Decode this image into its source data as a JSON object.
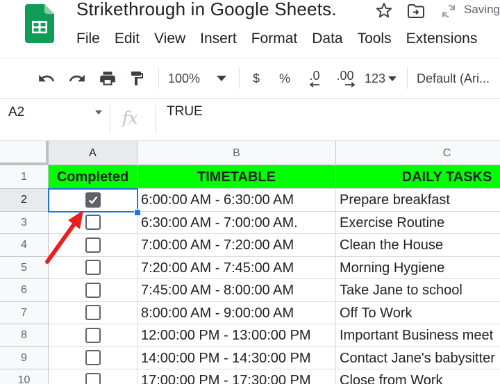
{
  "header": {
    "doc_title": "Strikethrough in Google Sheets.",
    "status": "Saving",
    "menu": [
      "File",
      "Edit",
      "View",
      "Insert",
      "Format",
      "Data",
      "Tools",
      "Extensions"
    ]
  },
  "toolbar": {
    "zoom": "100%",
    "currency": "$",
    "percent": "%",
    "decrease_decimal": ".0",
    "increase_decimal": ".00",
    "more_formats": "123",
    "font": "Default (Ari..."
  },
  "formula_bar": {
    "name_box": "A2",
    "fx": "fx",
    "value": "TRUE"
  },
  "sheet": {
    "columns": [
      "A",
      "B",
      "C"
    ],
    "header_row": {
      "number": "1",
      "completed": "Completed",
      "timetable": "TIMETABLE",
      "daily_tasks": "DAILY TASKS"
    },
    "rows": [
      {
        "number": "2",
        "checked": true,
        "time": "6:00:00 AM - 6:30:00 AM",
        "task": "Prepare breakfast"
      },
      {
        "number": "3",
        "checked": false,
        "time": "6:30:00 AM - 7:00:00 AM.",
        "task": "Exercise Routine"
      },
      {
        "number": "4",
        "checked": false,
        "time": "7:00:00 AM - 7:20:00 AM",
        "task": "Clean the House"
      },
      {
        "number": "5",
        "checked": false,
        "time": "7:20:00 AM - 7:45:00 AM",
        "task": "Morning Hygiene"
      },
      {
        "number": "6",
        "checked": false,
        "time": "7:45:00 AM - 8:00:00 AM",
        "task": "Take Jane to school"
      },
      {
        "number": "7",
        "checked": false,
        "time": "8:00:00 AM - 9:00:00 AM",
        "task": "Off To Work"
      },
      {
        "number": "8",
        "checked": false,
        "time": "12:00:00 PM - 13:00:00 PM",
        "task": "Important Business meet"
      },
      {
        "number": "9",
        "checked": false,
        "time": "14:00:00 PM - 14:30:00 PM",
        "task": "Contact Jane's babysitter"
      },
      {
        "number": "10",
        "checked": false,
        "time": "17:00:00 PM - 17:30:00 PM",
        "task": "Close from Work"
      }
    ]
  },
  "colors": {
    "header_fill": "#00ff00",
    "selection": "#1a73e8",
    "annotation_arrow": "#e8201d",
    "sheets_green": "#0f9d58"
  }
}
